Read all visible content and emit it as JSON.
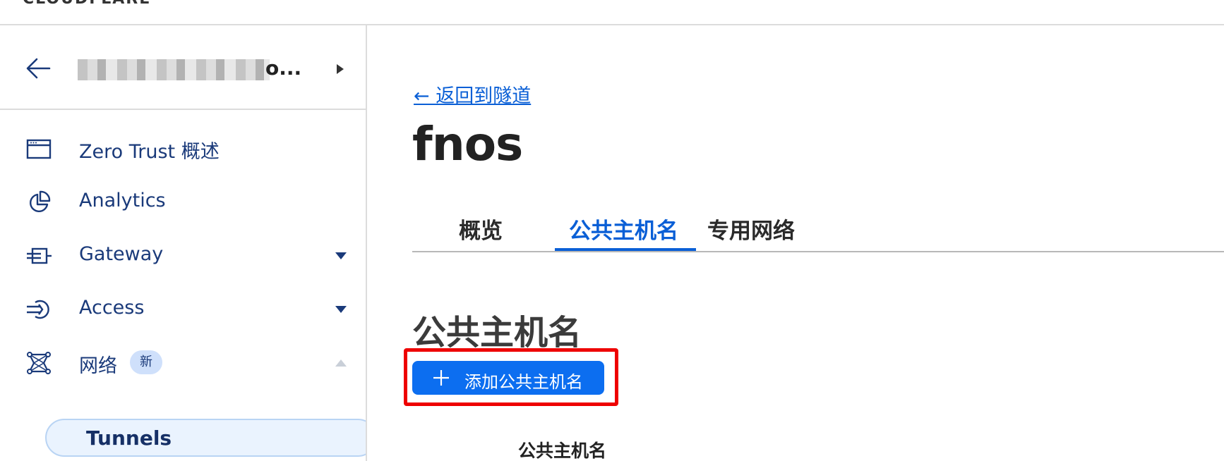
{
  "topbar": {
    "brand": "CLOUDFLARE"
  },
  "sidebar": {
    "account_name_suffix": "o...",
    "items": [
      {
        "label": "Zero Trust 概述",
        "icon": "browser-window-icon"
      },
      {
        "label": "Analytics",
        "icon": "pie-chart-icon"
      },
      {
        "label": "Gateway",
        "icon": "gateway-icon",
        "expandable": true
      },
      {
        "label": "Access",
        "icon": "access-icon",
        "expandable": true
      },
      {
        "label": "网络",
        "icon": "network-icon",
        "badge": "新",
        "expanded": true
      }
    ],
    "sub_items": [
      {
        "label": "Tunnels",
        "active": true
      }
    ]
  },
  "main": {
    "back_link": "← 返回到隧道",
    "title": "fnos",
    "tabs": [
      {
        "label": "概览",
        "active": false
      },
      {
        "label": "公共主机名",
        "active": true
      },
      {
        "label": "专用网络",
        "active": false
      }
    ],
    "section_title": "公共主机名",
    "add_button_label": "添加公共主机名",
    "table": {
      "columns": [
        "公共主机名"
      ]
    }
  },
  "colors": {
    "accent": "#0c6ef0",
    "link": "#0a5fd6",
    "highlight": "#ee0000",
    "nav_text": "#1a3a7a"
  }
}
